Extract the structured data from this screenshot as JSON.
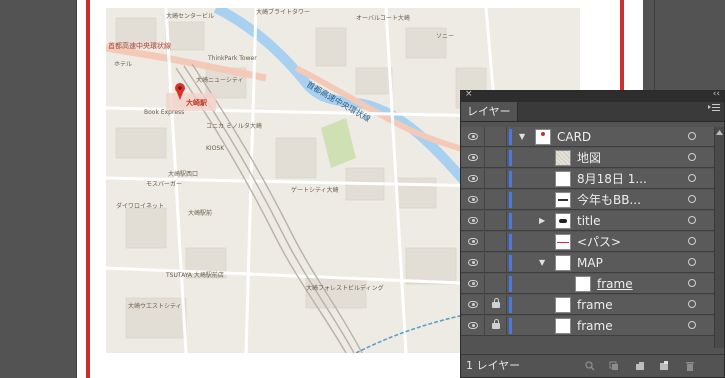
{
  "panel": {
    "close": "×",
    "collapse": "‹‹",
    "tab_label": "レイヤー",
    "menu_icon": "panel-menu-icon",
    "footer_count": "1 レイヤー"
  },
  "layers": [
    {
      "name": "CARD",
      "visible": true,
      "locked": false,
      "twisty": "▼",
      "indent": 0,
      "thumb": "card"
    },
    {
      "name": "地図",
      "visible": true,
      "locked": false,
      "twisty": "",
      "indent": 1,
      "thumb": "map"
    },
    {
      "name": "8月18日 1...",
      "visible": true,
      "locked": false,
      "twisty": "",
      "indent": 1,
      "thumb": "blank"
    },
    {
      "name": "今年もBB...",
      "visible": true,
      "locked": false,
      "twisty": "",
      "indent": 1,
      "thumb": "text"
    },
    {
      "name": "title",
      "visible": true,
      "locked": false,
      "twisty": "▶",
      "indent": 1,
      "thumb": "title"
    },
    {
      "name": "<パス>",
      "visible": true,
      "locked": false,
      "twisty": "",
      "indent": 1,
      "thumb": "path"
    },
    {
      "name": "MAP",
      "visible": true,
      "locked": false,
      "twisty": "▼",
      "indent": 1,
      "thumb": "blank"
    },
    {
      "name": "frame",
      "visible": true,
      "locked": false,
      "twisty": "",
      "indent": 2,
      "thumb": "blank",
      "underline": true
    },
    {
      "name": "frame",
      "visible": true,
      "locked": true,
      "twisty": "",
      "indent": 1,
      "thumb": "blank"
    },
    {
      "name": "frame",
      "visible": true,
      "locked": true,
      "twisty": "",
      "indent": 1,
      "thumb": "blank"
    }
  ],
  "map": {
    "labels_red": [
      "首都高速中央環状線"
    ],
    "labels_blue": [
      "首都高速中央環状線"
    ],
    "station": "大崎駅",
    "labels": [
      "大崎駅西口",
      "大崎ニューシティ",
      "ゲートシティ大崎",
      "大崎ブライトタワー",
      "Book Express",
      "ThinkPark Tower",
      "大崎ウエストシティ",
      "TSUTAYA 大崎駅前店",
      "モスバーガー",
      "ダイワロイネット",
      "ホテル",
      "大崎センタービル",
      "ソニー",
      "コニカ ミノルタ大崎",
      "オーバルコート大崎",
      "大崎フォレストビルディング",
      "KIOSK",
      "大崎駅前"
    ]
  },
  "colors": {
    "guide_red": "#c9302c",
    "layer_bar_blue": "#4a7ae0",
    "panel_bg": "#535353"
  }
}
